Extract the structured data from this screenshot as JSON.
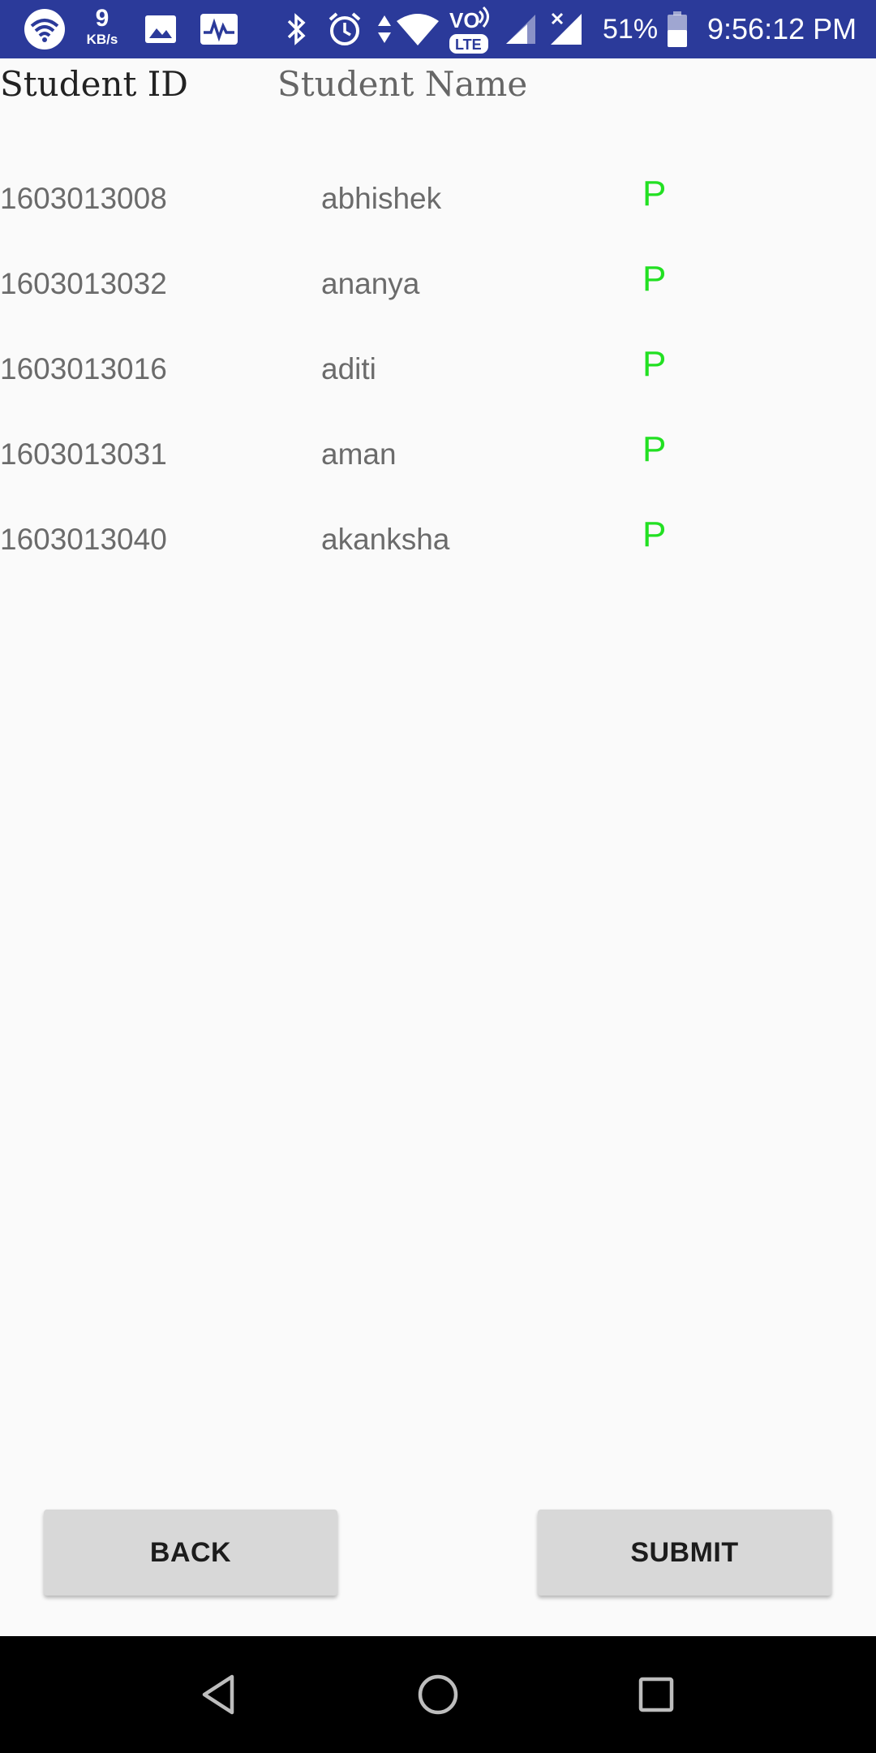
{
  "status_bar": {
    "net_speed_value": "9",
    "net_speed_unit": "KB/s",
    "battery_percent": "51%",
    "time": "9:56:12 PM",
    "icons": [
      "wifi-icon",
      "image-icon",
      "activity-icon",
      "bluetooth-icon",
      "alarm-icon",
      "data-arrows-icon",
      "wifi-signal-icon",
      "volte-icon",
      "signal-icon",
      "signal-x-icon",
      "battery-icon"
    ]
  },
  "header": {
    "student_id": "Student ID",
    "student_name": "Student Name"
  },
  "students": [
    {
      "id": "1603013008",
      "name": "abhishek",
      "status": "P"
    },
    {
      "id": "1603013032",
      "name": "ananya",
      "status": "P"
    },
    {
      "id": "1603013016",
      "name": "aditi",
      "status": "P"
    },
    {
      "id": "1603013031",
      "name": "aman",
      "status": "P"
    },
    {
      "id": "1603013040",
      "name": "akanksha",
      "status": "P"
    }
  ],
  "buttons": {
    "back": "BACK",
    "submit": "SUBMIT"
  },
  "colors": {
    "status_bar": "#2b3a9a",
    "present": "#22e022",
    "button_bg": "#d8d8d8"
  },
  "nav": [
    "back-triangle-icon",
    "home-circle-icon",
    "recents-square-icon"
  ]
}
